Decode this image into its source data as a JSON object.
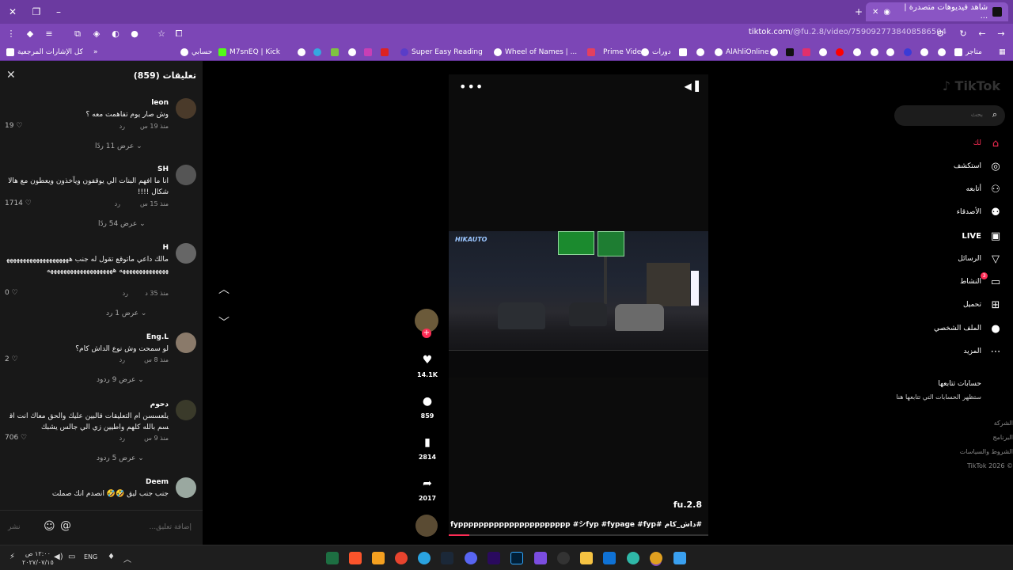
{
  "browser": {
    "tab_title": "شاهد فيديوهات متصدرة | ...",
    "url_domain": "tiktok.com",
    "url_path": "/@fu.2.8/video/7590927738408586504",
    "bookmarks": [
      {
        "label": "متاجر"
      },
      {
        "label": "AlAhliOnline"
      },
      {
        "label": "دورات"
      },
      {
        "label": "Prime Video"
      },
      {
        "label": "Wheel of Names | ..."
      },
      {
        "label": "Super Easy Reading"
      },
      {
        "label": "M7snEQ | Kick"
      },
      {
        "label": "حسابي"
      },
      {
        "label": "كل الإشارات المرجعية"
      }
    ]
  },
  "comments": {
    "title": "تعليقات (859)",
    "items": [
      {
        "user": "leon",
        "text": "وش صار يوم تفاهمت معه ؟",
        "time": "منذ 19 س",
        "reply": "رد",
        "likes": "19",
        "replies": "عرض 11 ردًا"
      },
      {
        "user": "SH",
        "text": "انا ما افهم البنات الي يوقفون ويآخذون ويعطون مع هالاشكال !!!!",
        "time": "منذ 15 س",
        "reply": "رد",
        "likes": "1714",
        "replies": "عرض 54 ردًا"
      },
      {
        "user": "H",
        "text": "مالك داعي ماتوقع تقول له جنب ههههههههههههههههههههههههههههههههههه ههههههههههههههههههههه",
        "time": "منذ 35 د",
        "reply": "رد",
        "likes": "0",
        "replies": "عرض 1 رد"
      },
      {
        "user": "Eng.L",
        "text": "لو سمحت وش نوع الداش كام؟",
        "time": "منذ 8 س",
        "reply": "رد",
        "likes": "2",
        "replies": "عرض 9 ردود"
      },
      {
        "user": "دحوم",
        "text": "يلعسسن ام التعليقات قالبين عليك والحق معاك انت اقسم بالله كلهم واطيين زي الي جالس يشبك",
        "time": "منذ 9 س",
        "reply": "رد",
        "likes": "706",
        "replies": "عرض 5 ردود"
      },
      {
        "user": "Deem",
        "text": "جنب جنب ليق 🤣🤣 انصدم انك صملت",
        "time": "",
        "reply": "",
        "likes": "",
        "replies": ""
      }
    ],
    "input_placeholder": "إضافة تعليق...",
    "post_label": "نشر"
  },
  "video": {
    "username": "fu.2.8",
    "caption": "#داش_كام #fypppppppppppppppppppppp #シfyp #fypage #fyp",
    "watermark": "HIKAUTO",
    "progress": 0.08
  },
  "actions": {
    "likes": "14.1K",
    "comments": "859",
    "saves": "2814",
    "shares": "2017"
  },
  "sidebar": {
    "search_placeholder": "بحث",
    "nav": [
      {
        "label": "لك",
        "icon": "home-icon",
        "active": true
      },
      {
        "label": "استكشف",
        "icon": "compass-icon"
      },
      {
        "label": "أتابعه",
        "icon": "person-check-icon"
      },
      {
        "label": "الأصدقاء",
        "icon": "friends-icon"
      },
      {
        "label": "LIVE",
        "icon": "live-icon"
      },
      {
        "label": "الرسائل",
        "icon": "send-icon"
      },
      {
        "label": "النشاط",
        "icon": "activity-icon",
        "badge": "3"
      },
      {
        "label": "تحميل",
        "icon": "upload-icon"
      },
      {
        "label": "الملف الشخصي",
        "icon": "profile-icon"
      },
      {
        "label": "المزيد",
        "icon": "more-icon"
      }
    ],
    "following_title": "حسابات تتابعها",
    "following_sub": "ستظهر الحسابات التي تتابعها هنا",
    "footer": [
      "الشركة",
      "البرنامج",
      "الشروط والسياسات",
      "© 2026 TikTok"
    ]
  },
  "taskbar": {
    "time": "١٢:٠٠ ص",
    "date": "٢٠٢٧/٠٧/١٥",
    "lang": "ENG"
  },
  "colors": {
    "accent": "#fe2c55",
    "browser": "#7c46b6"
  }
}
